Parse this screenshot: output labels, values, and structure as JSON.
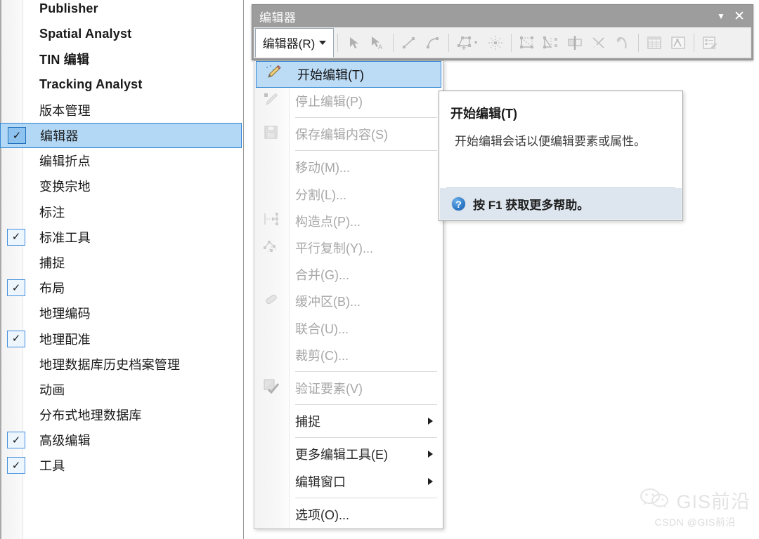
{
  "toolbar_list": {
    "name": "toolbars-list-menu",
    "items": [
      {
        "label": "Publisher",
        "checked": false,
        "latin": true,
        "selected": false
      },
      {
        "label": "Spatial Analyst",
        "checked": false,
        "latin": true,
        "selected": false
      },
      {
        "label": "TIN 编辑",
        "checked": false,
        "latin": true,
        "selected": false
      },
      {
        "label": "Tracking Analyst",
        "checked": false,
        "latin": true,
        "selected": false
      },
      {
        "label": "版本管理",
        "checked": false,
        "latin": false,
        "selected": false
      },
      {
        "label": "编辑器",
        "checked": true,
        "latin": false,
        "selected": true
      },
      {
        "label": "编辑折点",
        "checked": false,
        "latin": false,
        "selected": false
      },
      {
        "label": "变换宗地",
        "checked": false,
        "latin": false,
        "selected": false
      },
      {
        "label": "标注",
        "checked": false,
        "latin": false,
        "selected": false
      },
      {
        "label": "标准工具",
        "checked": true,
        "latin": false,
        "selected": false
      },
      {
        "label": "捕捉",
        "checked": false,
        "latin": false,
        "selected": false
      },
      {
        "label": "布局",
        "checked": true,
        "latin": false,
        "selected": false
      },
      {
        "label": "地理编码",
        "checked": false,
        "latin": false,
        "selected": false
      },
      {
        "label": "地理配准",
        "checked": true,
        "latin": false,
        "selected": false
      },
      {
        "label": "地理数据库历史档案管理",
        "checked": false,
        "latin": false,
        "selected": false
      },
      {
        "label": "动画",
        "checked": false,
        "latin": false,
        "selected": false
      },
      {
        "label": "分布式地理数据库",
        "checked": false,
        "latin": false,
        "selected": false
      },
      {
        "label": "高级编辑",
        "checked": true,
        "latin": false,
        "selected": false
      },
      {
        "label": "工具",
        "checked": true,
        "latin": false,
        "selected": false
      }
    ],
    "check_glyph": "✓"
  },
  "editor_window": {
    "title": "编辑器",
    "caret_glyph": "▼",
    "close_glyph": "✕",
    "menu_button_label": "编辑器(R)",
    "toolbar_icons": [
      {
        "name": "edit-tool-icon",
        "enabled": false
      },
      {
        "name": "edit-annotation-tool-icon",
        "enabled": false
      },
      {
        "name": "straight-segment-icon",
        "enabled": false
      },
      {
        "name": "curve-segment-icon",
        "enabled": false
      },
      {
        "name": "construct-polygon-icon",
        "enabled": false
      },
      {
        "name": "rotate-icon",
        "enabled": false
      },
      {
        "name": "trace-icon",
        "enabled": false
      },
      {
        "name": "split-tool-icon",
        "enabled": false
      },
      {
        "name": "mirror-features-icon",
        "enabled": false
      },
      {
        "name": "cut-polygons-icon",
        "enabled": false
      },
      {
        "name": "reshape-feature-icon",
        "enabled": false
      },
      {
        "name": "attributes-table-icon",
        "enabled": false
      },
      {
        "name": "sketch-properties-icon",
        "enabled": false
      },
      {
        "name": "create-features-icon",
        "enabled": false
      }
    ]
  },
  "editor_menu": {
    "items": [
      {
        "type": "item",
        "label": "开始编辑(T)",
        "icon": "start-editing-icon",
        "enabled": true,
        "highlight": true,
        "submenu": false
      },
      {
        "type": "item",
        "label": "停止编辑(P)",
        "icon": "stop-editing-icon",
        "enabled": false,
        "highlight": false,
        "submenu": false
      },
      {
        "type": "sep"
      },
      {
        "type": "item",
        "label": "保存编辑内容(S)",
        "icon": "save-edits-icon",
        "enabled": false,
        "highlight": false,
        "submenu": false
      },
      {
        "type": "sep"
      },
      {
        "type": "item",
        "label": "移动(M)...",
        "icon": "",
        "enabled": false,
        "highlight": false,
        "submenu": false
      },
      {
        "type": "item",
        "label": "分割(L)...",
        "icon": "",
        "enabled": false,
        "highlight": false,
        "submenu": false
      },
      {
        "type": "item",
        "label": "构造点(P)...",
        "icon": "construct-points-icon",
        "enabled": false,
        "highlight": false,
        "submenu": false
      },
      {
        "type": "item",
        "label": "平行复制(Y)...",
        "icon": "copy-parallel-icon",
        "enabled": false,
        "highlight": false,
        "submenu": false
      },
      {
        "type": "item",
        "label": "合并(G)...",
        "icon": "",
        "enabled": false,
        "highlight": false,
        "submenu": false
      },
      {
        "type": "item",
        "label": "缓冲区(B)...",
        "icon": "buffer-icon",
        "enabled": false,
        "highlight": false,
        "submenu": false
      },
      {
        "type": "item",
        "label": "联合(U)...",
        "icon": "",
        "enabled": false,
        "highlight": false,
        "submenu": false
      },
      {
        "type": "item",
        "label": "裁剪(C)...",
        "icon": "",
        "enabled": false,
        "highlight": false,
        "submenu": false
      },
      {
        "type": "sep"
      },
      {
        "type": "item",
        "label": "验证要素(V)",
        "icon": "validate-features-icon",
        "enabled": false,
        "highlight": false,
        "submenu": false
      },
      {
        "type": "sep"
      },
      {
        "type": "item",
        "label": "捕捉",
        "icon": "",
        "enabled": true,
        "highlight": false,
        "submenu": true
      },
      {
        "type": "sep"
      },
      {
        "type": "item",
        "label": "更多编辑工具(E)",
        "icon": "",
        "enabled": true,
        "highlight": false,
        "submenu": true
      },
      {
        "type": "item",
        "label": "编辑窗口",
        "icon": "",
        "enabled": true,
        "highlight": false,
        "submenu": true
      },
      {
        "type": "sep"
      },
      {
        "type": "item",
        "label": "选项(O)...",
        "icon": "",
        "enabled": true,
        "highlight": false,
        "submenu": false
      }
    ]
  },
  "tooltip": {
    "title": "开始编辑(T)",
    "body": "开始编辑会话以便编辑要素或属性。",
    "help_text": "按 F1 获取更多帮助。",
    "help_icon_glyph": "?"
  },
  "watermark": {
    "brand": "GIS前沿",
    "sub": "CSDN @GIS前沿",
    "icon": "wechat-icon"
  },
  "colors": {
    "selection_fill": "#b3d8f5",
    "selection_border": "#2f86d4",
    "titlebar": "#9d9d9d",
    "menu_highlight": "#bcdcf6",
    "tooltip_footer": "#dde5ee"
  }
}
